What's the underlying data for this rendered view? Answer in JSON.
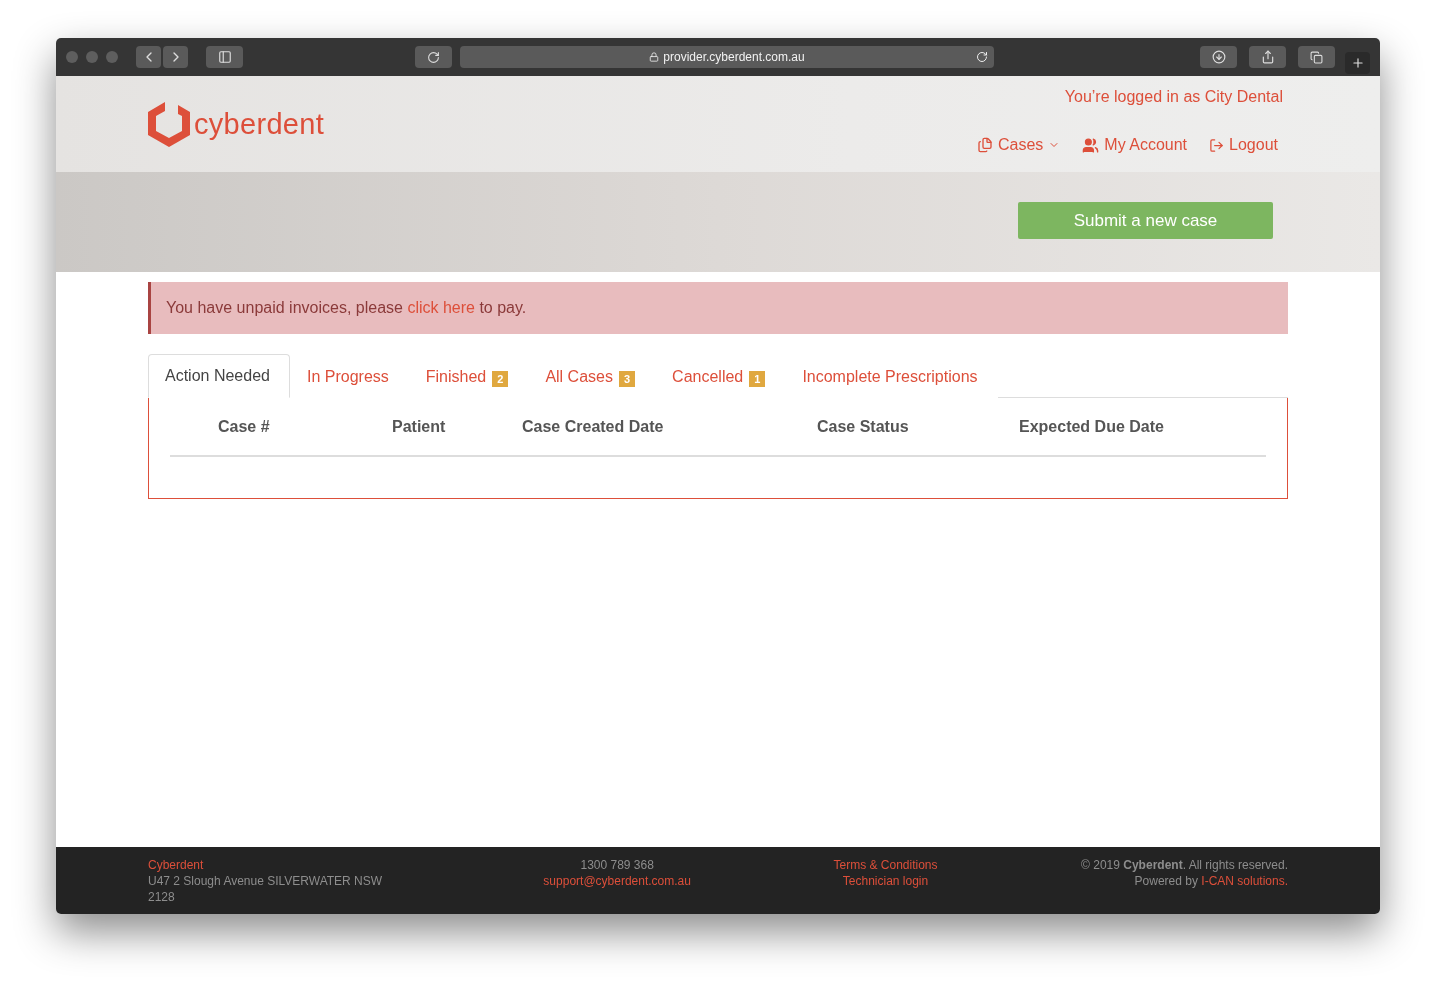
{
  "browser": {
    "url": "provider.cyberdent.com.au"
  },
  "header": {
    "logo_text": "cyberdent",
    "login_text": "You’re logged in as City Dental",
    "nav": [
      {
        "kind": "dropdown",
        "label": "Cases"
      },
      {
        "kind": "account",
        "label": "My Account"
      },
      {
        "kind": "logout",
        "label": "Logout"
      }
    ],
    "submit_button": "Submit a new case"
  },
  "alert": {
    "before": "You have unpaid invoices, please ",
    "link": "click here",
    "after": " to pay."
  },
  "tabs": [
    {
      "label": "Action Needed",
      "selected": true
    },
    {
      "label": "In Progress",
      "selected": false
    },
    {
      "label": "Finished",
      "badge": "2",
      "selected": false
    },
    {
      "label": "All Cases",
      "badge": "3",
      "selected": false
    },
    {
      "label": "Cancelled",
      "badge": "1",
      "selected": false
    },
    {
      "label": "Incomplete Prescriptions",
      "selected": false
    }
  ],
  "table": {
    "columns": [
      "Case #",
      "Patient",
      "Case Created Date",
      "Case Status",
      "Expected Due Date"
    ]
  },
  "footer": {
    "company": "Cyberdent",
    "address": "U47 2 Slough Avenue SILVERWATER NSW 2128",
    "phone": "1300 789 368",
    "email": "support@cyberdent.com.au",
    "links": [
      "Terms & Conditions",
      "Technician login"
    ],
    "copyright": "© 2019 **Cyberdent**. All rights reserved.",
    "powered_before": "Powered by ",
    "powered_link": "I-CAN solutions."
  }
}
